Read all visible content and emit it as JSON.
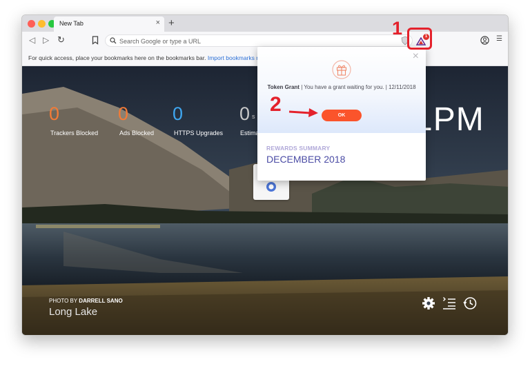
{
  "browser": {
    "tab_title": "New Tab",
    "tab_close": "×",
    "new_tab": "+",
    "url_placeholder": "Search Google or type a URL",
    "back": "◁",
    "forward": "▷",
    "reload": "↻",
    "menu": "☰",
    "rewards_badge": "1"
  },
  "bookmarks_bar": {
    "text": "For quick access, place your bookmarks here on the bookmarks bar.",
    "link": "Import bookmarks no"
  },
  "ntp": {
    "stats": [
      {
        "value": "0",
        "label": "Trackers Blocked",
        "color": "#f27b37"
      },
      {
        "value": "0",
        "label": "Ads Blocked",
        "color": "#f27b37"
      },
      {
        "value": "0",
        "label": "HTTPS Upgrades",
        "color": "#3fa6f0"
      },
      {
        "value": "0",
        "label": "Estima",
        "color": "#c8c8c8"
      }
    ],
    "stat_suffix": "s",
    "clock": "1PM",
    "photo_prefix": "PHOTO BY",
    "photo_author": "DARRELL SANO",
    "photo_location": "Long Lake"
  },
  "popup": {
    "close": "×",
    "grant_title": "Token Grant",
    "grant_text": "| You have a grant waiting for you. | 12/11/2018",
    "ok_label": "OK",
    "summary_label": "REWARDS SUMMARY",
    "summary_month": "DECEMBER 2018"
  },
  "annotations": {
    "step1": "1",
    "step2": "2",
    "color": "#e4212b"
  }
}
